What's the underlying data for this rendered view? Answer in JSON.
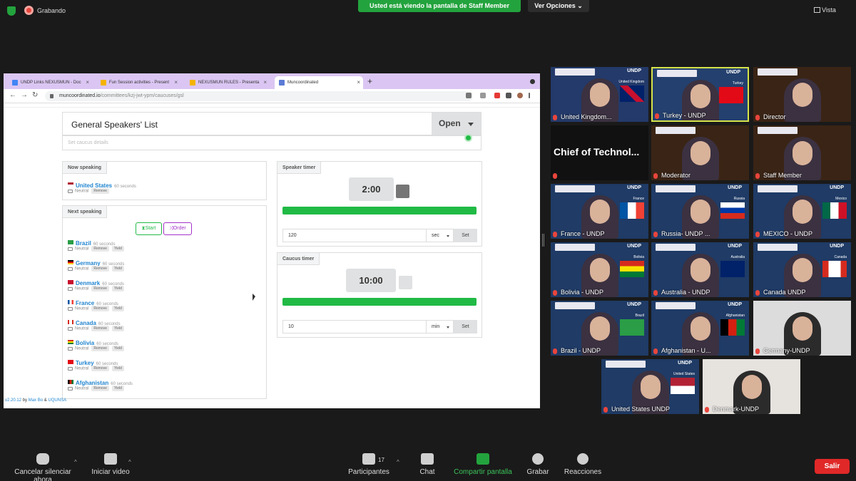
{
  "zoom": {
    "recording_label": "Grabando",
    "share_banner": "Usted está viendo la pantalla de Staff Member",
    "view_options": "Ver Opciones",
    "view_label": "Vista",
    "participant_count": "17",
    "exit_label": "Salir"
  },
  "toolbar": {
    "unmute": "Cancelar silenciar ahora",
    "start_video": "Iniciar video",
    "participants": "Participantes",
    "chat": "Chat",
    "share": "Compartir pantalla",
    "record": "Grabar",
    "reactions": "Reacciones"
  },
  "browser": {
    "tabs": [
      {
        "label": "UNDP Links NEXUSMUN - Doc",
        "color": "#4285f4"
      },
      {
        "label": "Fun Session activities - Present",
        "color": "#f4b400"
      },
      {
        "label": "NEXUSMUN RULES - Presenta",
        "color": "#f4b400"
      },
      {
        "label": "Muncoordinated",
        "color": "#5b7bd5"
      }
    ],
    "url_host": "muncoordinated.io",
    "url_path": "/committees/kzj-jwt-ypm/caucuses/gsl"
  },
  "app": {
    "title": "General Speakers' List",
    "status": "Open",
    "details_placeholder": "Set caucus details",
    "now_speaking_header": "Now speaking",
    "now_speaking": {
      "name": "United States",
      "duration": "60 seconds",
      "stance": "Neutral",
      "remove": "Remove"
    },
    "next_speaking_header": "Next speaking",
    "start_label": "Start",
    "order_label": "Order",
    "queue": [
      {
        "name": "Brazil",
        "duration": "60 seconds",
        "stance": "Neutral",
        "remove": "Remove",
        "yield": "Yield"
      },
      {
        "name": "Germany",
        "duration": "60 seconds",
        "stance": "Neutral",
        "remove": "Remove",
        "yield": "Yield"
      },
      {
        "name": "Denmark",
        "duration": "60 seconds",
        "stance": "Neutral",
        "remove": "Remove",
        "yield": "Yield"
      },
      {
        "name": "France",
        "duration": "60 seconds",
        "stance": "Neutral",
        "remove": "Remove",
        "yield": "Yield"
      },
      {
        "name": "Canada",
        "duration": "60 seconds",
        "stance": "Neutral",
        "remove": "Remove",
        "yield": "Yield"
      },
      {
        "name": "Bolivia",
        "duration": "60 seconds",
        "stance": "Neutral",
        "remove": "Remove",
        "yield": "Yield"
      },
      {
        "name": "Turkey",
        "duration": "60 seconds",
        "stance": "Neutral",
        "remove": "Remove",
        "yield": "Yield"
      },
      {
        "name": "Afghanistan",
        "duration": "60 seconds",
        "stance": "Neutral",
        "remove": "Remove",
        "yield": "Yield"
      }
    ],
    "speaker_timer": {
      "header": "Speaker timer",
      "value": "2:00",
      "input": "120",
      "unit": "sec",
      "set": "Set",
      "progress": 1.0
    },
    "caucus_timer": {
      "header": "Caucus timer",
      "value": "10:00",
      "input": "10",
      "unit": "min",
      "set": "Set",
      "progress": 1.0
    },
    "footer_version": "v2.20.12",
    "footer_by": "by",
    "footer_author1": "Max Bo",
    "footer_and": "&",
    "footer_author2": "UQUNSA"
  },
  "participants": [
    {
      "label": "United Kingdom...",
      "flag_caption": "United Kingdom"
    },
    {
      "label": "Turkey - UNDP",
      "flag_caption": "Turkey"
    },
    {
      "label": "Director"
    },
    {
      "label": "",
      "name_card": "Chief of Technol..."
    },
    {
      "label": "Moderator"
    },
    {
      "label": "Staff Member"
    },
    {
      "label": "France - UNDP",
      "flag_caption": "France"
    },
    {
      "label": "Russia- UNDP ...",
      "flag_caption": "Russia"
    },
    {
      "label": "MEXICO - UNDP",
      "flag_caption": "Mexico"
    },
    {
      "label": "Bolivia - UNDP",
      "flag_caption": "Bolivia"
    },
    {
      "label": "Australia - UNDP",
      "flag_caption": "Australia"
    },
    {
      "label": "Canada UNDP",
      "flag_caption": "Canada"
    },
    {
      "label": "Brazil - UNDP",
      "flag_caption": "Brazil"
    },
    {
      "label": "Afghanistan - U...",
      "flag_caption": "Afghanistan"
    },
    {
      "label": "Germany-UNDP"
    },
    {
      "label": "United States UNDP",
      "flag_caption": "United States"
    },
    {
      "label": "Denmark-UNDP"
    }
  ],
  "tile_brand": "UNDP",
  "colors": {
    "accent_green": "#23a33d",
    "progress_green": "#21ba45",
    "link_blue": "#2185d0",
    "exit_red": "#e02828",
    "tab_bar": "#dbc6f3"
  }
}
